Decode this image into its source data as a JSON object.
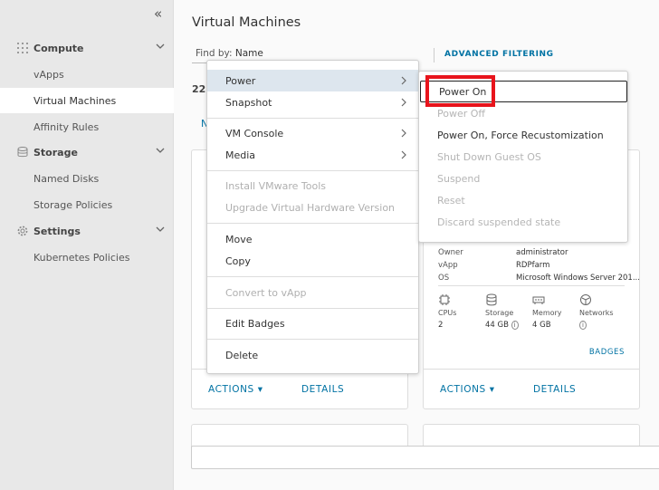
{
  "sidebar": {
    "collapse_glyph": "«",
    "groups": [
      {
        "label": "Compute",
        "icon": "grid-icon"
      },
      {
        "label": "Storage",
        "icon": "database-icon"
      },
      {
        "label": "Settings",
        "icon": "gear-icon"
      }
    ],
    "items": {
      "vapps": "vApps",
      "virtual_machines": "Virtual Machines",
      "affinity_rules": "Affinity Rules",
      "named_disks": "Named Disks",
      "storage_policies": "Storage Policies",
      "kubernetes_policies": "Kubernetes Policies"
    },
    "active_item": "Virtual Machines"
  },
  "main": {
    "title": "Virtual Machines",
    "find_by_label": "Find by:",
    "find_by_value": "Name",
    "advanced_filtering": "ADVANCED FILTERING",
    "count": "22",
    "new_link": "N"
  },
  "cards": [
    {
      "actions": "ACTIONS",
      "details": "DETAILS"
    },
    {
      "actions": "ACTIONS",
      "details": "DETAILS",
      "properties": [
        {
          "key": "Owner",
          "value": "administrator"
        },
        {
          "key": "vApp",
          "value": "RDPfarm"
        },
        {
          "key": "OS",
          "value": "Microsoft Windows Server 201..."
        }
      ],
      "resources": [
        {
          "label": "CPUs",
          "value": "2",
          "icon": "cpu-icon"
        },
        {
          "label": "Storage",
          "value": "44 GB",
          "icon": "storage-icon"
        },
        {
          "label": "Memory",
          "value": "4 GB",
          "icon": "memory-icon"
        },
        {
          "label": "Networks",
          "value": "",
          "icon": "network-icon"
        }
      ],
      "badges": "BADGES"
    }
  ],
  "context_menu": {
    "items": [
      {
        "label": "Power",
        "submenu": true,
        "selected": true
      },
      {
        "label": "Snapshot",
        "submenu": true
      },
      {
        "label": "VM Console",
        "submenu": true
      },
      {
        "label": "Media",
        "submenu": true
      },
      {
        "label": "Install VMware Tools",
        "disabled": true
      },
      {
        "label": "Upgrade Virtual Hardware Version",
        "disabled": true
      },
      {
        "label": "Move"
      },
      {
        "label": "Copy"
      },
      {
        "label": "Convert to vApp",
        "disabled": true
      },
      {
        "label": "Edit Badges"
      },
      {
        "label": "Delete"
      }
    ]
  },
  "power_submenu": {
    "items": [
      {
        "label": "Power On",
        "focused": true
      },
      {
        "label": "Power Off",
        "disabled": true
      },
      {
        "label": "Power On, Force Recustomization"
      },
      {
        "label": "Shut Down Guest OS",
        "disabled": true
      },
      {
        "label": "Suspend",
        "disabled": true
      },
      {
        "label": "Reset",
        "disabled": true
      },
      {
        "label": "Discard suspended state",
        "disabled": true
      }
    ]
  },
  "colors": {
    "link": "#0072a3",
    "sidebar_bg": "#e8e8e8",
    "menu_selected": "#dde6ee",
    "highlight": "#e8141c"
  }
}
